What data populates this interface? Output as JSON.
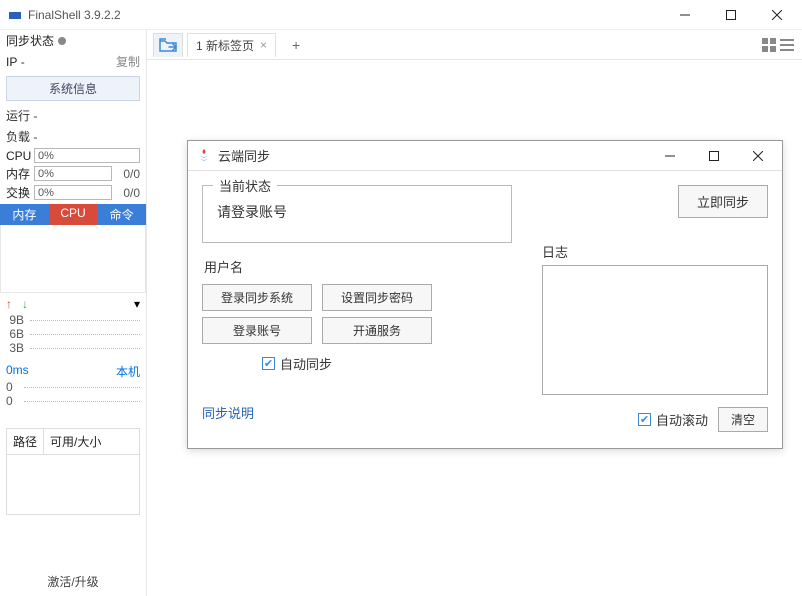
{
  "titlebar": {
    "title": "FinalShell 3.9.2.2"
  },
  "sidebar": {
    "sync_status_label": "同步状态",
    "ip_label": "IP",
    "ip_value": "-",
    "copy_label": "复制",
    "sysinfo_btn": "系统信息",
    "run_label": "运行",
    "run_value": "-",
    "load_label": "负载",
    "load_value": "-",
    "cpu_label": "CPU",
    "cpu_value": "0%",
    "mem_label": "内存",
    "mem_value": "0%",
    "mem_side": "0/0",
    "swap_label": "交换",
    "swap_value": "0%",
    "swap_side": "0/0",
    "tabs": {
      "mem": "内存",
      "cpu": "CPU",
      "cmd": "命令"
    },
    "net_ticks": [
      "9B",
      "6B",
      "3B"
    ],
    "latency": "0ms",
    "host_label": "本机",
    "lat_ticks": [
      "0",
      "0"
    ],
    "table_cols": {
      "path": "路径",
      "usage": "可用/大小"
    },
    "activate": "激活/升级"
  },
  "toolbar": {
    "tab_label": "1 新标签页"
  },
  "dialog": {
    "title": "云端同步",
    "status_legend": "当前状态",
    "status_text": "请登录账号",
    "sync_now": "立即同步",
    "user_label": "用户名",
    "btn_login_sync": "登录同步系统",
    "btn_set_pwd": "设置同步密码",
    "btn_login": "登录账号",
    "btn_open_svc": "开通服务",
    "auto_sync": "自动同步",
    "sync_help": "同步说明",
    "log_label": "日志",
    "auto_scroll": "自动滚动",
    "clear": "清空"
  }
}
